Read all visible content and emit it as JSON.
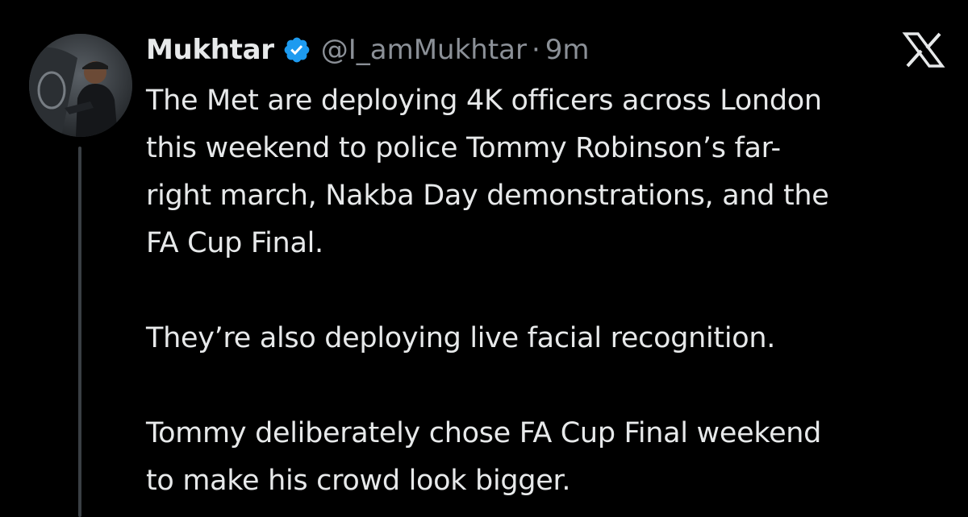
{
  "tweet": {
    "author": {
      "display_name": "Mukhtar",
      "handle": "@I_amMukhtar",
      "separator": "·",
      "time": "9m",
      "verified_icon": "verified-badge-icon",
      "avatar": "profile-avatar"
    },
    "platform_icon": "x-logo-icon",
    "text_lines": [
      "The Met are deploying 4K officers across London",
      "this weekend to police Tommy Robinson’s far-",
      "right march, Nakba Day demonstrations, and the",
      "FA Cup Final.",
      "They’re also deploying live facial recognition.",
      "Tommy deliberately chose FA Cup Final weekend",
      "to make his crowd look bigger."
    ]
  },
  "colors": {
    "background": "#000000",
    "text_primary": "#e7e9ea",
    "text_secondary": "#8b9097",
    "verified_blue": "#1d9bf0",
    "thread_line": "#3a3f44"
  }
}
